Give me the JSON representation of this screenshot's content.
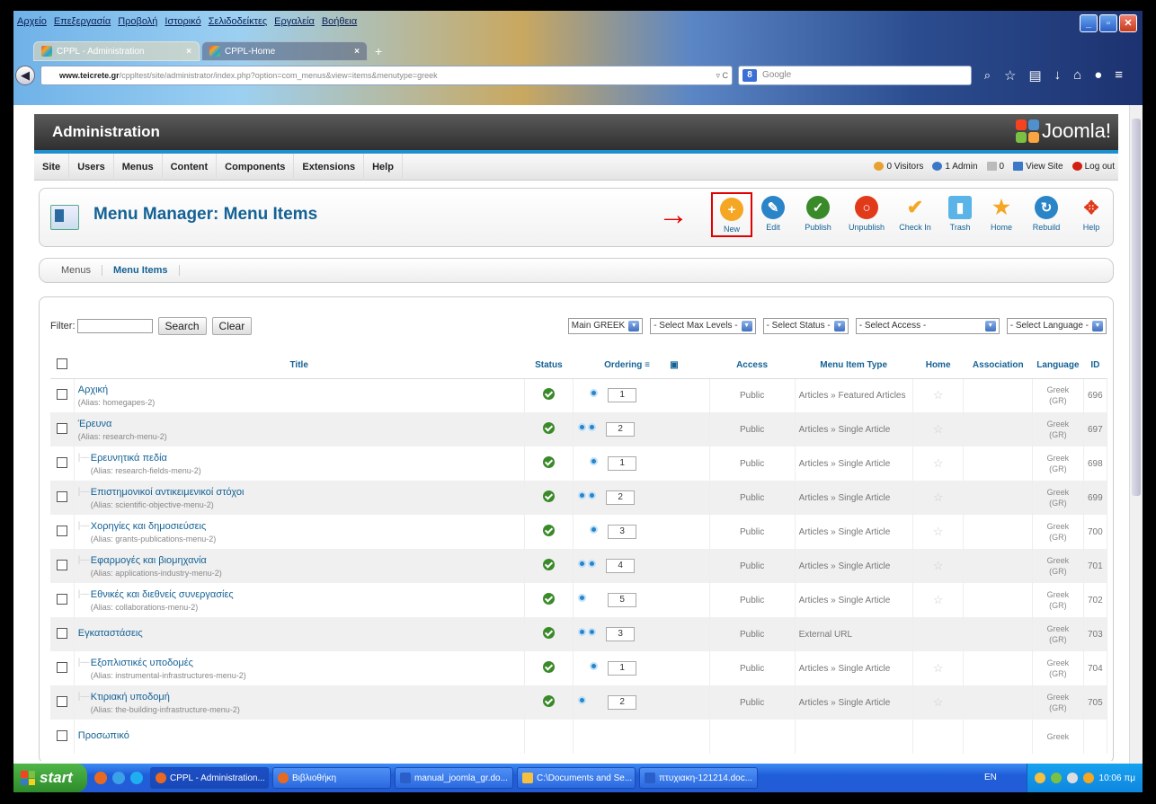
{
  "browser": {
    "menu": [
      "Αρχείο",
      "Επεξεργασία",
      "Προβολή",
      "Ιστορικό",
      "Σελιδοδείκτες",
      "Εργαλεία",
      "Βοήθεια"
    ],
    "tabs": [
      {
        "label": "CPPL - Administration"
      },
      {
        "label": "CPPL-Home"
      }
    ],
    "new_tab": "+",
    "url_host": "www.teicrete.gr",
    "url_path": "/cppltest/site/administrator/index.php?option=com_menus&view=items&menutype=greek",
    "search_placeholder": "Google",
    "search_engine": "8"
  },
  "header": {
    "title": "Administration",
    "logo_text": "Joomla!"
  },
  "admin_menu": [
    "Site",
    "Users",
    "Menus",
    "Content",
    "Components",
    "Extensions",
    "Help"
  ],
  "status": {
    "visitors": "0 Visitors",
    "admins": "1 Admin",
    "messages": "0",
    "view_site": "View Site",
    "logout": "Log out"
  },
  "toolbar": {
    "page_title": "Menu Manager: Menu Items",
    "arrow": "→",
    "buttons": {
      "new": "New",
      "edit": "Edit",
      "publish": "Publish",
      "unpublish": "Unpublish",
      "checkin": "Check In",
      "trash": "Trash",
      "home": "Home",
      "rebuild": "Rebuild",
      "help": "Help"
    }
  },
  "submenu": [
    "Menus",
    "Menu Items"
  ],
  "filter": {
    "label": "Filter:",
    "search": "Search",
    "clear": "Clear",
    "menu_select": "Main GREEK",
    "levels_select": "- Select Max Levels -",
    "status_select": "- Select Status -",
    "access_select": "- Select Access -",
    "language_select": "- Select Language -"
  },
  "columns": {
    "title": "Title",
    "status": "Status",
    "ordering": "Ordering",
    "access": "Access",
    "type": "Menu Item Type",
    "home": "Home",
    "association": "Association",
    "language": "Language",
    "id": "ID"
  },
  "rows": [
    {
      "title": "Αρχική",
      "alias": "(Alias: homegapes-2)",
      "order": "1",
      "access": "Public",
      "type": "Articles » Featured Articles",
      "lang1": "Greek",
      "lang2": "(GR)",
      "id": "696"
    },
    {
      "title": "Έρευνα",
      "alias": "(Alias: research-menu-2)",
      "order": "2",
      "access": "Public",
      "type": "Articles » Single Article",
      "lang1": "Greek",
      "lang2": "(GR)",
      "id": "697"
    },
    {
      "title": "Ερευνητικά πεδία",
      "alias": "(Alias: research-fields-menu-2)",
      "order": "1",
      "access": "Public",
      "type": "Articles » Single Article",
      "lang1": "Greek",
      "lang2": "(GR)",
      "id": "698"
    },
    {
      "title": "Επιστημονικοί αντικειμενικοί στόχοι",
      "alias": "(Alias: scientific-objective-menu-2)",
      "order": "2",
      "access": "Public",
      "type": "Articles » Single Article",
      "lang1": "Greek",
      "lang2": "(GR)",
      "id": "699"
    },
    {
      "title": "Χορηγίες και δημοσιεύσεις",
      "alias": "(Alias: grants-publications-menu-2)",
      "order": "3",
      "access": "Public",
      "type": "Articles » Single Article",
      "lang1": "Greek",
      "lang2": "(GR)",
      "id": "700"
    },
    {
      "title": "Εφαρμογές και βιομηχανία",
      "alias": "(Alias: applications-industry-menu-2)",
      "order": "4",
      "access": "Public",
      "type": "Articles » Single Article",
      "lang1": "Greek",
      "lang2": "(GR)",
      "id": "701"
    },
    {
      "title": "Εθνικές και διεθνείς συνεργασίες",
      "alias": "(Alias: collaborations-menu-2)",
      "order": "5",
      "access": "Public",
      "type": "Articles » Single Article",
      "lang1": "Greek",
      "lang2": "(GR)",
      "id": "702"
    },
    {
      "title": "Εγκαταστάσεις",
      "alias": "",
      "order": "3",
      "access": "Public",
      "type": "External URL",
      "lang1": "Greek",
      "lang2": "(GR)",
      "id": "703"
    },
    {
      "title": "Εξοπλιστικές υποδομές",
      "alias": "(Alias: instrumental-infrastructures-menu-2)",
      "order": "1",
      "access": "Public",
      "type": "Articles » Single Article",
      "lang1": "Greek",
      "lang2": "(GR)",
      "id": "704"
    },
    {
      "title": "Κτιριακή υποδομή",
      "alias": "(Alias: the-building-infrastructure-menu-2)",
      "order": "2",
      "access": "Public",
      "type": "Articles » Single Article",
      "lang1": "Greek",
      "lang2": "(GR)",
      "id": "705"
    },
    {
      "title": "Προσωπικό",
      "alias": "",
      "order": "",
      "access": "",
      "type": "",
      "lang1": "Greek",
      "lang2": "",
      "id": ""
    }
  ],
  "taskbar": {
    "start": "start",
    "tasks": [
      "CPPL - Administration...",
      "Βιβλιοθήκη",
      "manual_joomla_gr.do...",
      "C:\\Documents and Se...",
      "πτυχιακη-121214.doc..."
    ],
    "lang": "EN",
    "clock": "10:06 πμ"
  }
}
